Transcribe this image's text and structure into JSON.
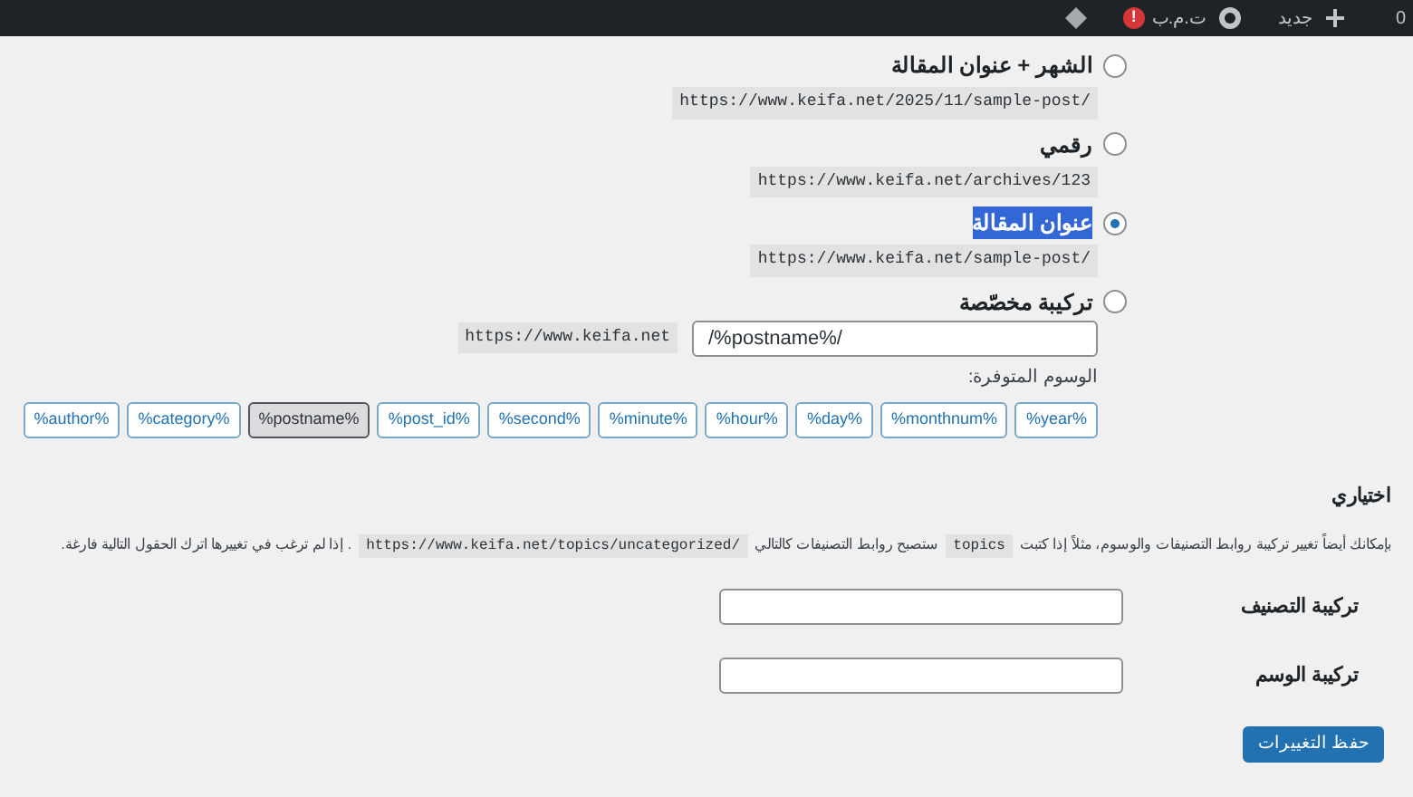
{
  "admin_bar": {
    "counter": "0",
    "new_label": "جديد",
    "user_name": "ت.م.ب",
    "alert_badge": "!"
  },
  "permalink_options": [
    {
      "kind": "preset",
      "label": "الشهر + عنوان المقالة",
      "example": "https://www.keifa.net/2025/11/sample-post/",
      "selected": false,
      "highlighted": false
    },
    {
      "kind": "preset",
      "label": "رقمي",
      "example": "https://www.keifa.net/archives/123",
      "selected": false,
      "highlighted": false
    },
    {
      "kind": "preset",
      "label": "عنوان المقالة",
      "example": "https://www.keifa.net/sample-post/",
      "selected": true,
      "highlighted": true
    },
    {
      "kind": "custom",
      "label": "تركيبة مخصّصة",
      "base": "https://www.keifa.net",
      "value": "/%postname%/",
      "selected": false,
      "highlighted": false
    }
  ],
  "available_tags_label": "الوسوم المتوفرة:",
  "tags": [
    {
      "label": "%year%",
      "selected": false
    },
    {
      "label": "%monthnum%",
      "selected": false
    },
    {
      "label": "%day%",
      "selected": false
    },
    {
      "label": "%hour%",
      "selected": false
    },
    {
      "label": "%minute%",
      "selected": false
    },
    {
      "label": "%second%",
      "selected": false
    },
    {
      "label": "%post_id%",
      "selected": false
    },
    {
      "label": "%postname%",
      "selected": true
    },
    {
      "label": "%category%",
      "selected": false
    },
    {
      "label": "%author%",
      "selected": false
    }
  ],
  "optional": {
    "heading": "اختياري",
    "description": [
      {
        "kind": "text",
        "text": "بإمكانك أيضاً تغيير تركيبة روابط التصنيفات والوسوم، مثلاً إذا كتبت"
      },
      {
        "kind": "code",
        "text": "topics"
      },
      {
        "kind": "text",
        "text": "ستصبح روابط التصنيفات كالتالي"
      },
      {
        "kind": "code",
        "text": "https://www.keifa.net/topics/uncategorized/"
      },
      {
        "kind": "text",
        "text": ". إذا لم ترغب في تغييرها اترك الحقول التالية فارغة."
      }
    ]
  },
  "base_fields": [
    {
      "label": "تركيبة التصنيف"
    },
    {
      "label": "تركيبة الوسم"
    }
  ],
  "save_button": "حفظ التغييرات"
}
